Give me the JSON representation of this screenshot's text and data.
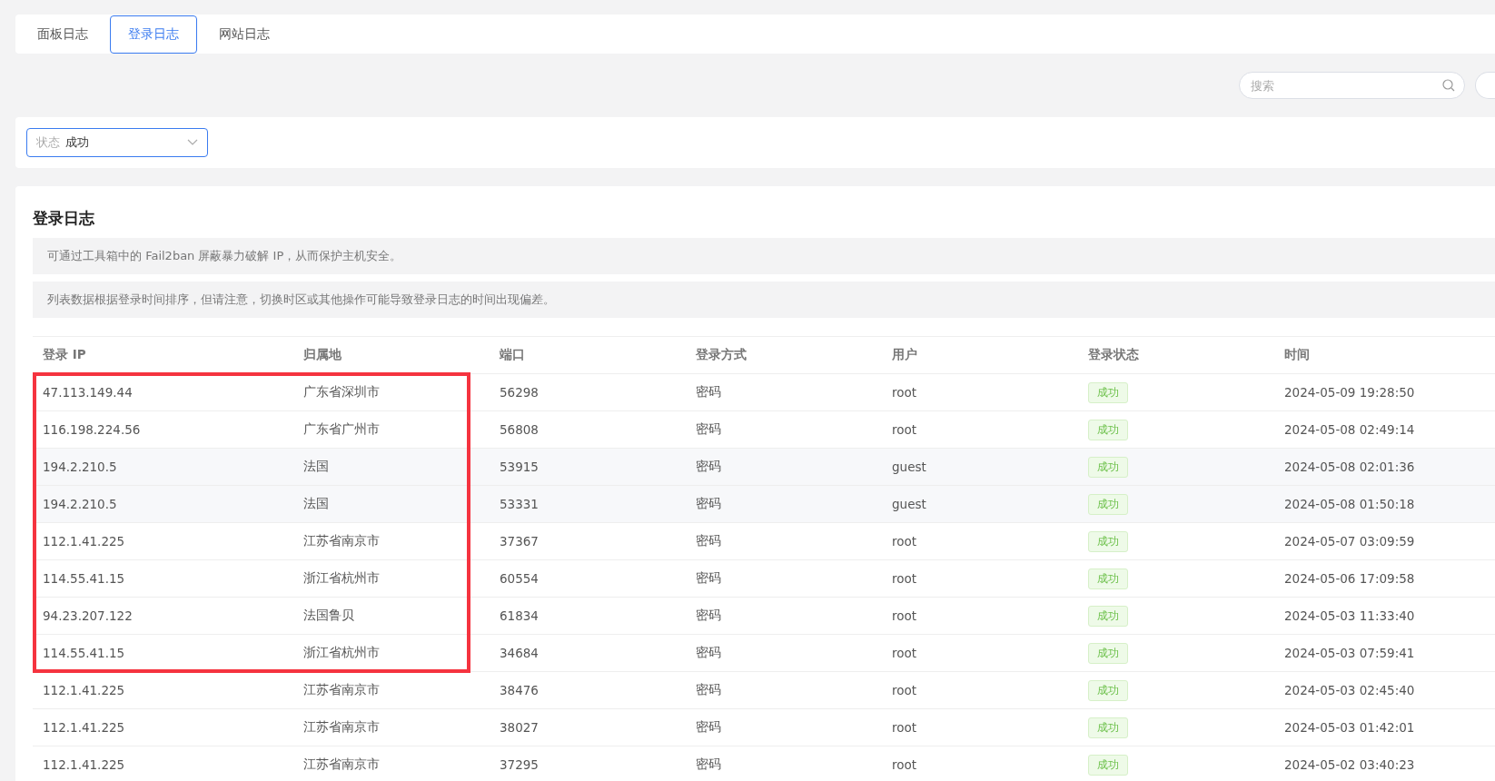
{
  "tabs": [
    {
      "label": "面板日志",
      "selected": false
    },
    {
      "label": "登录日志",
      "selected": true
    },
    {
      "label": "网站日志",
      "selected": false
    }
  ],
  "search": {
    "placeholder": "搜索"
  },
  "filter": {
    "label": "状态",
    "value": "成功"
  },
  "panel": {
    "title": "登录日志",
    "notices": [
      "可通过工具箱中的 Fail2ban 屏蔽暴力破解 IP，从而保护主机安全。",
      "列表数据根据登录时间排序，但请注意，切换时区或其他操作可能导致登录日志的时间出现偏差。"
    ]
  },
  "table": {
    "columns": [
      "登录 IP",
      "归属地",
      "端口",
      "登录方式",
      "用户",
      "登录状态",
      "时间"
    ],
    "rows": [
      {
        "ip": "47.113.149.44",
        "location": "广东省深圳市",
        "port": "56298",
        "method": "密码",
        "user": "root",
        "status": "成功",
        "time": "2024-05-09 19:28:50",
        "shaded": false,
        "marked": true
      },
      {
        "ip": "116.198.224.56",
        "location": "广东省广州市",
        "port": "56808",
        "method": "密码",
        "user": "root",
        "status": "成功",
        "time": "2024-05-08 02:49:14",
        "shaded": false,
        "marked": true
      },
      {
        "ip": "194.2.210.5",
        "location": "法国",
        "port": "53915",
        "method": "密码",
        "user": "guest",
        "status": "成功",
        "time": "2024-05-08 02:01:36",
        "shaded": true,
        "marked": true
      },
      {
        "ip": "194.2.210.5",
        "location": "法国",
        "port": "53331",
        "method": "密码",
        "user": "guest",
        "status": "成功",
        "time": "2024-05-08 01:50:18",
        "shaded": true,
        "marked": true
      },
      {
        "ip": "112.1.41.225",
        "location": "江苏省南京市",
        "port": "37367",
        "method": "密码",
        "user": "root",
        "status": "成功",
        "time": "2024-05-07 03:09:59",
        "shaded": false,
        "marked": true
      },
      {
        "ip": "114.55.41.15",
        "location": "浙江省杭州市",
        "port": "60554",
        "method": "密码",
        "user": "root",
        "status": "成功",
        "time": "2024-05-06 17:09:58",
        "shaded": false,
        "marked": true
      },
      {
        "ip": "94.23.207.122",
        "location": "法国鲁贝",
        "port": "61834",
        "method": "密码",
        "user": "root",
        "status": "成功",
        "time": "2024-05-03 11:33:40",
        "shaded": false,
        "marked": true
      },
      {
        "ip": "114.55.41.15",
        "location": "浙江省杭州市",
        "port": "34684",
        "method": "密码",
        "user": "root",
        "status": "成功",
        "time": "2024-05-03 07:59:41",
        "shaded": false,
        "marked": true
      },
      {
        "ip": "112.1.41.225",
        "location": "江苏省南京市",
        "port": "38476",
        "method": "密码",
        "user": "root",
        "status": "成功",
        "time": "2024-05-03 02:45:40",
        "shaded": false,
        "marked": false
      },
      {
        "ip": "112.1.41.225",
        "location": "江苏省南京市",
        "port": "38027",
        "method": "密码",
        "user": "root",
        "status": "成功",
        "time": "2024-05-03 01:42:01",
        "shaded": false,
        "marked": false
      },
      {
        "ip": "112.1.41.225",
        "location": "江苏省南京市",
        "port": "37295",
        "method": "密码",
        "user": "root",
        "status": "成功",
        "time": "2024-05-02 03:40:23",
        "shaded": false,
        "marked": false
      }
    ]
  }
}
